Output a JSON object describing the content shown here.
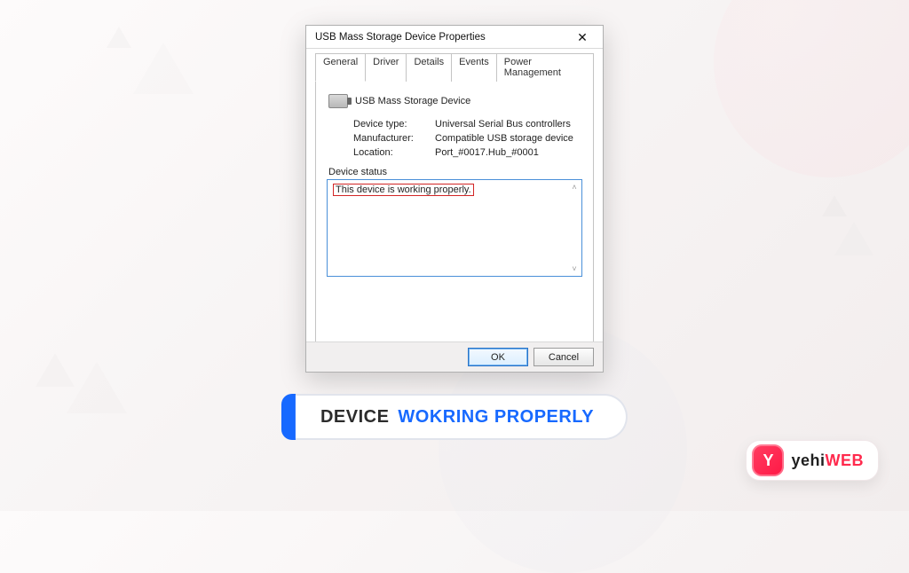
{
  "dialog": {
    "title": "USB Mass Storage Device Properties",
    "close_glyph": "✕",
    "tabs": [
      "General",
      "Driver",
      "Details",
      "Events",
      "Power Management"
    ],
    "active_tab": 0,
    "device_name": "USB Mass Storage Device",
    "props": {
      "device_type_label": "Device type:",
      "device_type_value": "Universal Serial Bus controllers",
      "manufacturer_label": "Manufacturer:",
      "manufacturer_value": "Compatible USB storage device",
      "location_label": "Location:",
      "location_value": "Port_#0017.Hub_#0001"
    },
    "status_label": "Device status",
    "status_text": "This device is working properly.",
    "ok_label": "OK",
    "cancel_label": "Cancel"
  },
  "caption": {
    "text1": "DEVICE",
    "text2": "WOKRING PROPERLY"
  },
  "brand": {
    "logo_glyph": "Y",
    "name_a": "yehi",
    "name_b": "WEB"
  }
}
